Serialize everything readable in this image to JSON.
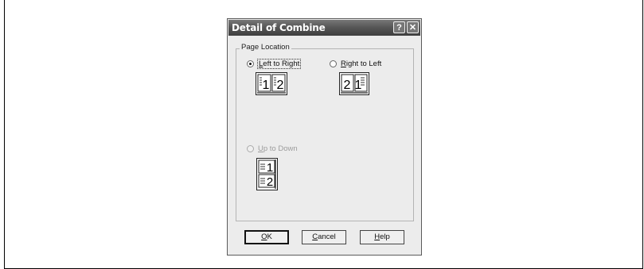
{
  "dialog": {
    "title": "Detail of Combine",
    "help_glyph": "?",
    "close_glyph": "✕",
    "group_label": "Page Location",
    "options": {
      "left_to_right": {
        "prefix": "",
        "accel": "L",
        "rest": "eft to Right",
        "selected": true,
        "enabled": true,
        "icon": "pages-1-2-horizontal-icon"
      },
      "right_to_left": {
        "prefix": "",
        "accel": "R",
        "rest": "ight to Left",
        "selected": false,
        "enabled": true,
        "icon": "pages-2-1-horizontal-icon"
      },
      "up_to_down": {
        "prefix": "",
        "accel": "U",
        "rest": "p to Down",
        "selected": false,
        "enabled": false,
        "icon": "pages-1-2-vertical-icon"
      }
    },
    "buttons": {
      "ok": {
        "accel": "O",
        "rest": "K"
      },
      "cancel": {
        "accel": "C",
        "rest": "ancel"
      },
      "help": {
        "accel": "H",
        "rest": "elp"
      }
    },
    "icon_digits": {
      "one": "1",
      "two": "2"
    }
  }
}
